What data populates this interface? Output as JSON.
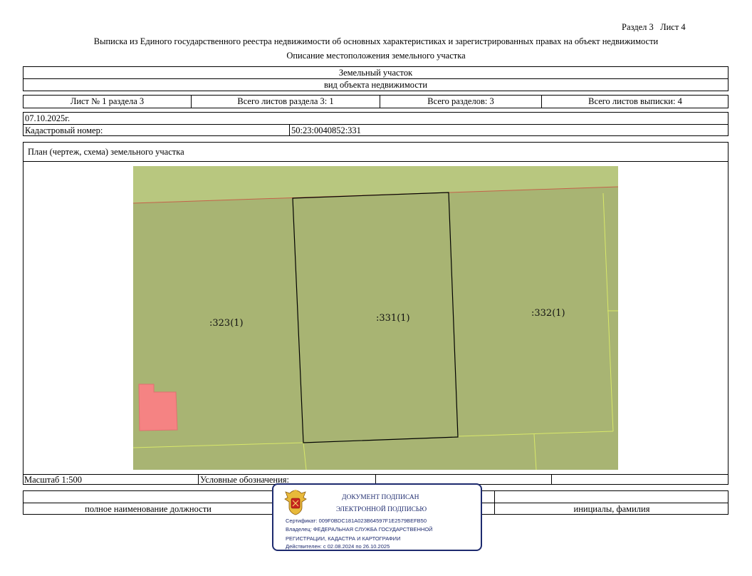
{
  "header": {
    "section_sheet": "Раздел 3   Лист 4",
    "title": "Выписка из Единого государственного реестра недвижимости об основных характеристиках и зарегистрированных правах на объект недвижимости",
    "subtitle": "Описание местоположения земельного участка"
  },
  "object": {
    "type": "Земельный участок",
    "type_caption": "вид объекта недвижимости"
  },
  "sheets": {
    "sheet_of_section": "Лист № 1 раздела 3",
    "total_sheets_section": "Всего листов раздела 3: 1",
    "total_sections": "Всего разделов: 3",
    "total_sheets_extract": "Всего листов выписки: 4"
  },
  "info": {
    "date": "07.10.2025г.",
    "cadastral_label": "Кадастровый номер:",
    "cadastral_number": "50:23:0040852:331"
  },
  "plan": {
    "title": "План (чертеж, схема) земельного участка",
    "labels": {
      "left": ":323(1)",
      "center": ":331(1)",
      "right": ":332(1)"
    },
    "colors": {
      "road": "#b8c77f",
      "parcel": "#a8b473",
      "building": "#f58383",
      "boundary": "#000000"
    }
  },
  "footer": {
    "scale": "Масштаб 1:500",
    "legend_label": "Условные обозначения:",
    "position_caption": "полное наименование должности",
    "name_caption": "инициалы, фамилия"
  },
  "stamp": {
    "line1": "ДОКУМЕНТ ПОДПИСАН",
    "line2": "ЭЛЕКТРОННОЙ ПОДПИСЬЮ",
    "certificate": "Сертификат: 009F0BDC181A023B64597F1E2579BEFB50",
    "owner1": "Владелец: ФЕДЕРАЛЬНАЯ СЛУЖБА ГОСУДАРСТВЕННОЙ",
    "owner2": "РЕГИСТРАЦИИ, КАДАСТРА И КАРТОГРАФИИ",
    "valid": "Действителен: с 02.08.2024 по 26.10.2025",
    "emblem": "eagle-emblem-icon"
  }
}
